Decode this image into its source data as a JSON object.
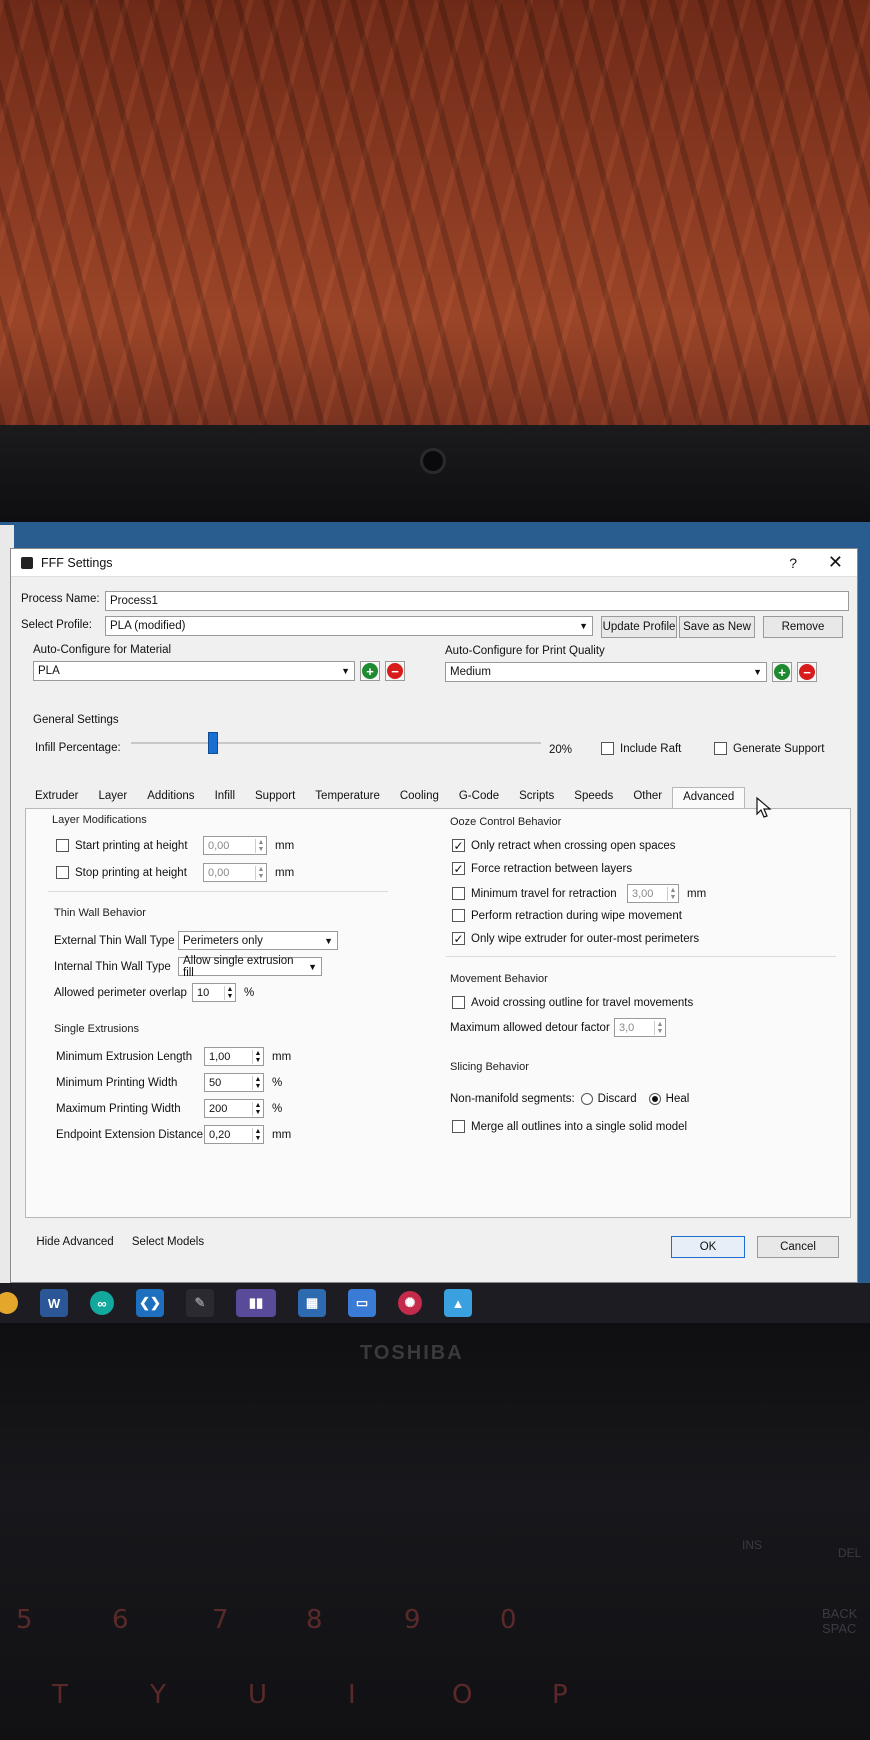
{
  "dialog": {
    "title": "FFF Settings",
    "help": "?",
    "close": "✕",
    "process_name_label": "Process Name:",
    "process_name_value": "Process1",
    "select_profile_label": "Select Profile:",
    "select_profile_value": "PLA (modified)",
    "update_profile": "Update Profile",
    "save_as_new": "Save as New",
    "remove": "Remove",
    "material_label": "Auto-Configure for Material",
    "material_value": "PLA",
    "quality_label": "Auto-Configure for Print Quality",
    "quality_value": "Medium",
    "general_settings": "General Settings",
    "infill_label": "Infill Percentage:",
    "infill_value": "20%",
    "infill_fraction": 0.2,
    "include_raft": "Include Raft",
    "generate_support": "Generate Support",
    "tabs": [
      "Extruder",
      "Layer",
      "Additions",
      "Infill",
      "Support",
      "Temperature",
      "Cooling",
      "G-Code",
      "Scripts",
      "Speeds",
      "Other",
      "Advanced"
    ],
    "active_tab": "Advanced"
  },
  "left": {
    "layer_mod": "Layer Modifications",
    "start_print": "Start printing at height",
    "start_value": "0,00",
    "stop_print": "Stop printing at height",
    "stop_value": "0,00",
    "mm": "mm",
    "thin_wall": "Thin Wall Behavior",
    "ext_thin": "External Thin Wall Type",
    "ext_thin_value": "Perimeters only",
    "int_thin": "Internal Thin Wall Type",
    "int_thin_value": "Allow single extrusion fill",
    "overlap": "Allowed perimeter overlap",
    "overlap_value": "10",
    "pct": "%",
    "single_ext": "Single Extrusions",
    "min_len": "Minimum Extrusion Length",
    "min_len_value": "1,00",
    "min_width": "Minimum Printing Width",
    "min_width_value": "50",
    "max_width": "Maximum Printing Width",
    "max_width_value": "200",
    "endpoint": "Endpoint Extension Distance",
    "endpoint_value": "0,20"
  },
  "right": {
    "ooze": "Ooze Control Behavior",
    "only_retract": "Only retract when crossing open spaces",
    "force_retract": "Force retraction between layers",
    "min_travel": "Minimum travel for retraction",
    "min_travel_value": "3,00",
    "mm": "mm",
    "wipe_retract": "Perform retraction during wipe movement",
    "only_wipe": "Only wipe extruder for outer-most perimeters",
    "movement": "Movement Behavior",
    "avoid_cross": "Avoid crossing outline for travel movements",
    "max_detour": "Maximum allowed detour factor",
    "max_detour_value": "3,0",
    "slicing": "Slicing Behavior",
    "non_manifold": "Non-manifold segments:",
    "discard": "Discard",
    "heal": "Heal",
    "merge": "Merge all outlines into a single solid model"
  },
  "footer": {
    "hide_advanced": "Hide Advanced",
    "select_models": "Select Models",
    "ok": "OK",
    "cancel": "Cancel"
  },
  "laptop": {
    "brand": "TOSHIBA",
    "keys_num": [
      "5",
      "6",
      "7",
      "8",
      "9",
      "0"
    ],
    "keys_letters": [
      "T",
      "Y",
      "U",
      "I",
      "O",
      "P"
    ],
    "backspace": "BACK SPAC",
    "ins": "INS",
    "del": "DEL"
  }
}
